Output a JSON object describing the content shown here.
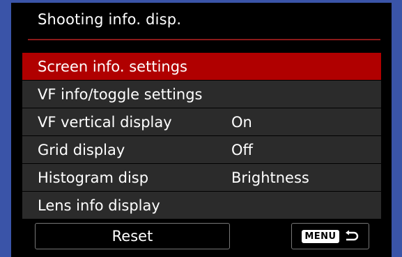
{
  "title": "Shooting info. disp.",
  "items": [
    {
      "label": "Screen info. settings",
      "value": ""
    },
    {
      "label": "VF info/toggle settings",
      "value": ""
    },
    {
      "label": "VF vertical display",
      "value": "On"
    },
    {
      "label": "Grid display",
      "value": "Off"
    },
    {
      "label": "Histogram disp",
      "value": "Brightness"
    },
    {
      "label": "Lens info display",
      "value": ""
    }
  ],
  "footer": {
    "reset_label": "Reset",
    "menu_label": "MENU",
    "back_icon": "return-arrow-icon"
  },
  "colors": {
    "selection": "#b00000",
    "item_background": "#2b2b2b",
    "frame": "#3a54a8"
  }
}
